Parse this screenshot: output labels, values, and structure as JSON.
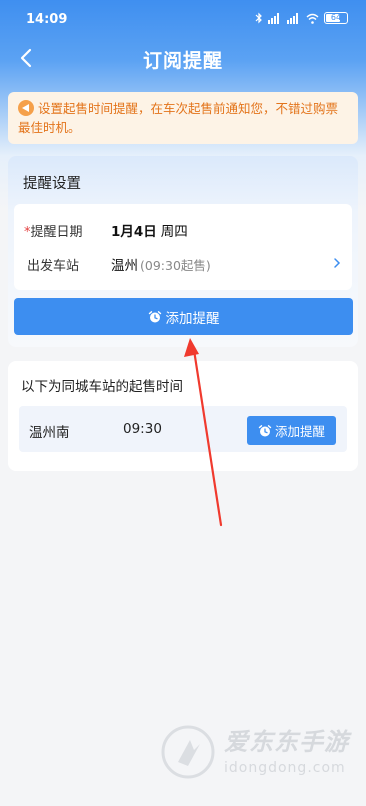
{
  "status_bar": {
    "time": "14:09",
    "battery": "64",
    "icons": [
      "bluetooth-icon",
      "signal-icon",
      "signal-icon",
      "wifi-icon",
      "battery-icon"
    ]
  },
  "nav": {
    "title": "订阅提醒",
    "back_icon": "back-arrow-icon"
  },
  "notice": {
    "text": "设置起售时间提醒，在车次起售前通知您，不错过购票最佳时机。",
    "icon": "horn-icon"
  },
  "settings": {
    "title": "提醒设置",
    "date_label_star": "*",
    "date_label": "提醒日期",
    "date_value": "1月4日",
    "weekday": "周四",
    "station_label": "出发车站",
    "station_name": "温州",
    "station_sale": "(09:30起售)",
    "add_button": "添加提醒"
  },
  "same_city": {
    "title": "以下为同城车站的起售时间",
    "stations": [
      {
        "name": "温州南",
        "time": "09:30",
        "button": "添加提醒"
      }
    ]
  },
  "watermark": {
    "title": "爱东东手游",
    "url": "idongdong.com"
  },
  "colors": {
    "accent": "#3d8ef0",
    "notice_text": "#e3741b",
    "notice_bg": "#fdf3e6",
    "arrow": "#f03a2e"
  }
}
